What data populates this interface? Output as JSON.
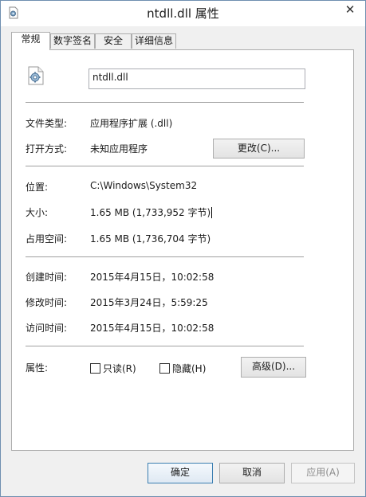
{
  "window": {
    "title": "ntdll.dll 属性",
    "close_glyph": "✕"
  },
  "tabs": [
    {
      "label": "常规"
    },
    {
      "label": "数字签名"
    },
    {
      "label": "安全"
    },
    {
      "label": "详细信息"
    }
  ],
  "file": {
    "name": "ntdll.dll"
  },
  "rows": {
    "type_label": "文件类型:",
    "type_value": "应用程序扩展 (.dll)",
    "open_label": "打开方式:",
    "open_value": "未知应用程序",
    "change_button": "更改(C)...",
    "location_label": "位置:",
    "location_value": "C:\\Windows\\System32",
    "size_label": "大小:",
    "size_value": "1.65 MB (1,733,952 字节)",
    "disk_label": "占用空间:",
    "disk_value": "1.65 MB (1,736,704 字节)",
    "created_label": "创建时间:",
    "created_value": "2015年4月15日，10:02:58",
    "modified_label": "修改时间:",
    "modified_value": "2015年3月24日，5:59:25",
    "accessed_label": "访问时间:",
    "accessed_value": "2015年4月15日，10:02:58",
    "attr_label": "属性:",
    "readonly_label": "只读(R)",
    "hidden_label": "隐藏(H)",
    "advanced_button": "高级(D)..."
  },
  "footer": {
    "ok": "确定",
    "cancel": "取消",
    "apply": "应用(A)"
  }
}
